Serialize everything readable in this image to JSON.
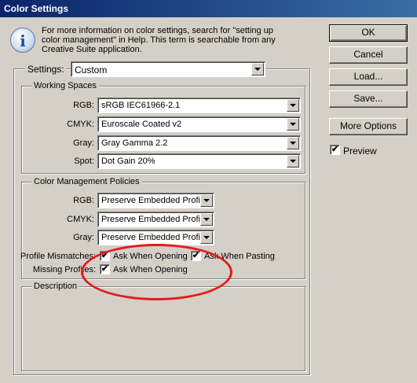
{
  "window": {
    "title": "Color Settings"
  },
  "info": {
    "icon": "info-icon",
    "line1": "For more information on color settings, search for \"setting up",
    "line2": "color management\" in Help. This term is searchable from any",
    "line3": "Creative Suite application."
  },
  "settings": {
    "label": "Settings:",
    "value": "Custom"
  },
  "working_spaces": {
    "title": "Working Spaces",
    "rows": [
      {
        "label": "RGB:",
        "value": "sRGB IEC61966-2.1"
      },
      {
        "label": "CMYK:",
        "value": "Euroscale Coated v2"
      },
      {
        "label": "Gray:",
        "value": "Gray Gamma 2.2"
      },
      {
        "label": "Spot:",
        "value": "Dot Gain 20%"
      }
    ]
  },
  "policies": {
    "title": "Color Management Policies",
    "rows": [
      {
        "label": "RGB:",
        "value": "Preserve Embedded Profiles"
      },
      {
        "label": "CMYK:",
        "value": "Preserve Embedded Profiles"
      },
      {
        "label": "Gray:",
        "value": "Preserve Embedded Profiles"
      }
    ],
    "profile_mismatches": {
      "label": "Profile Mismatches:",
      "ask_opening": {
        "label": "Ask When Opening",
        "checked": true
      },
      "ask_pasting": {
        "label": "Ask When Pasting",
        "checked": true
      }
    },
    "missing_profiles": {
      "label": "Missing Profiles:",
      "ask_opening": {
        "label": "Ask When Opening",
        "checked": true
      }
    }
  },
  "description": {
    "title": "Description"
  },
  "buttons": {
    "ok": "OK",
    "cancel": "Cancel",
    "load": "Load...",
    "save": "Save...",
    "more_options": "More Options"
  },
  "preview": {
    "label": "Preview",
    "checked": true
  },
  "check_glyph": "✔",
  "annotation_color": "#e41b1b"
}
